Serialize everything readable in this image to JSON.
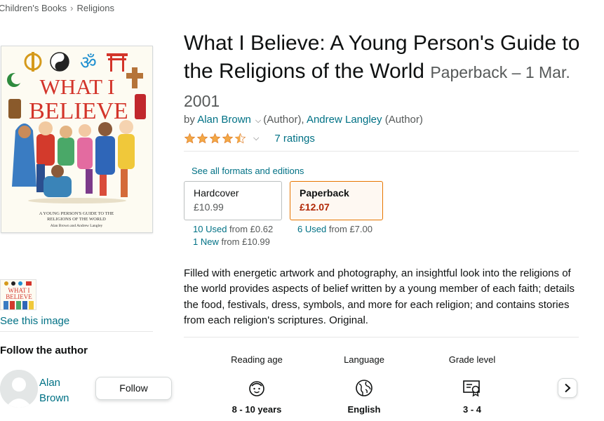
{
  "breadcrumb": [
    "Children's Books",
    "Religions"
  ],
  "cover": {
    "title_line1": "WHAT I",
    "title_line2": "BELIEVE",
    "subtitle_line1": "A YOUNG PERSON'S GUIDE TO THE",
    "subtitle_line2": "RELIGIONS OF THE WORLD",
    "authors": "Alan Brown and Andrew Langley"
  },
  "gallery": {
    "see_image_label": "See this image"
  },
  "author_panel": {
    "heading": "Follow the author",
    "author_name": "Alan Brown",
    "follow_label": "Follow"
  },
  "product": {
    "title": "What I Believe: A Young Person's Guide to the Religions of the World",
    "format_date": "Paperback – 1 Mar. 2001",
    "by": "by",
    "author1": "Alan Brown",
    "author1_role": "(Author),",
    "author2": "Andrew Langley",
    "author2_role": "(Author)",
    "rating": 4.5,
    "ratings_count": "7 ratings",
    "colors": {
      "star": "#f3a847",
      "link": "#007185",
      "price": "#b12704",
      "selected_border": "#e77600"
    }
  },
  "formats": {
    "see_all": "See all formats and editions",
    "options": [
      {
        "name": "Hardcover",
        "price": "£10.99",
        "selected": false
      },
      {
        "name": "Paperback",
        "price": "£12.07",
        "selected": true
      }
    ],
    "offers": {
      "hardcover_used_link": "10 Used",
      "hardcover_used_from": "from £0.62",
      "hardcover_new_link": "1 New",
      "hardcover_new_from": "from £10.99",
      "paperback_used_link": "6 Used",
      "paperback_used_from": "from £7.00"
    }
  },
  "description": "Filled with energetic artwork and photography, an insightful look into the religions of the world provides aspects of belief written by a young member of each faith; details the food, festivals, dress, symbols, and more for each religion; and contains stories from each religion's scriptures. Original.",
  "details": [
    {
      "label": "Reading age",
      "value": "8 - 10 years",
      "icon": "child-face-icon"
    },
    {
      "label": "Language",
      "value": "English",
      "icon": "globe-icon"
    },
    {
      "label": "Grade level",
      "value": "3 - 4",
      "icon": "certificate-icon"
    }
  ]
}
